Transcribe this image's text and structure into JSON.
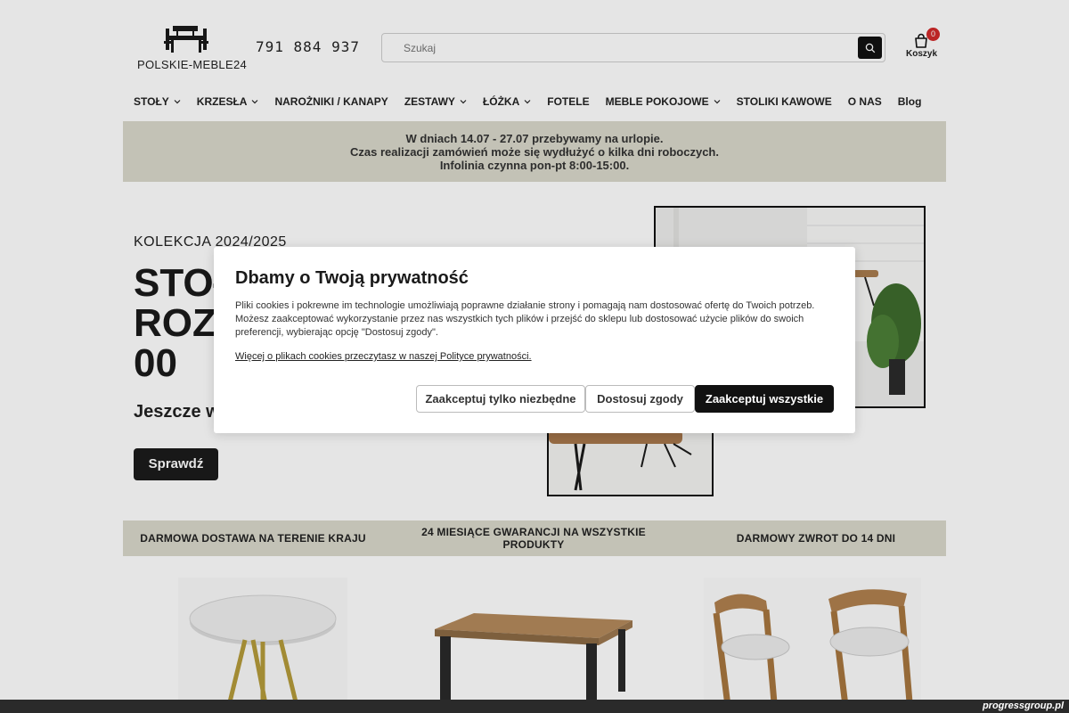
{
  "header": {
    "logo_text": "POLSKIE-MEBLE24",
    "phone": "791 884 937",
    "search_placeholder": "Szukaj",
    "cart_count": "0",
    "cart_label": "Koszyk"
  },
  "nav": {
    "items": [
      {
        "label": "STOŁY",
        "has_dropdown": true
      },
      {
        "label": "KRZESŁA",
        "has_dropdown": true
      },
      {
        "label": "NAROŻNIKI / KANAPY",
        "has_dropdown": false
      },
      {
        "label": "ZESTAWY",
        "has_dropdown": true
      },
      {
        "label": "ŁÓŻKA",
        "has_dropdown": true
      },
      {
        "label": "FOTELE",
        "has_dropdown": false
      },
      {
        "label": "MEBLE POKOJOWE",
        "has_dropdown": true
      },
      {
        "label": "STOLIKI KAWOWE",
        "has_dropdown": false
      },
      {
        "label": "O NAS",
        "has_dropdown": false
      },
      {
        "label": "Blog",
        "has_dropdown": false
      }
    ]
  },
  "notice": {
    "line1": "W dniach 14.07 - 27.07 przebywamy na urlopie.",
    "line2": "Czas realizacji zamówień może się wydłużyć o kilka dni roboczych.",
    "line3": "Infolinia czynna pon-pt 8:00-15:00."
  },
  "hero": {
    "kicker": "KOLEKCJA 2024/2025",
    "title_line1": "STOŁ",
    "title_line2": "ROZK",
    "title_line3": "00",
    "subtitle": "Jeszcze w",
    "button": "Sprawdź"
  },
  "usp": {
    "item1": "DARMOWA DOSTAWA NA TERENIE KRAJU",
    "item2": "24 MIESIĄCE GWARANCJI NA WSZYSTKIE PRODUKTY",
    "item3": "DARMOWY ZWROT DO 14 DNI"
  },
  "cookie_modal": {
    "title": "Dbamy o Twoją prywatność",
    "body": "Pliki cookies i pokrewne im technologie umożliwiają poprawne działanie strony i pomagają nam dostosować ofertę do Twoich potrzeb. Możesz zaakceptować wykorzystanie przez nas wszystkich tych plików i przejść do sklepu lub dostosować użycie plików do swoich preferencji, wybierając opcję \"Dostosuj zgody\".",
    "link": "Więcej o plikach cookies przeczytasz w naszej Polityce prywatności.",
    "btn_necessary": "Zaakceptuj tylko niezbędne",
    "btn_customize": "Dostosuj zgody",
    "btn_accept_all": "Zaakceptuj wszystkie"
  },
  "watermark": "progressgroup.pl",
  "colors": {
    "accent_band": "#dad9cb",
    "dark_button": "#111111",
    "cart_badge": "#d12a2a"
  },
  "icons": [
    "table-logo-icon",
    "search-icon",
    "shopping-bag-icon",
    "chevron-down-icon"
  ]
}
